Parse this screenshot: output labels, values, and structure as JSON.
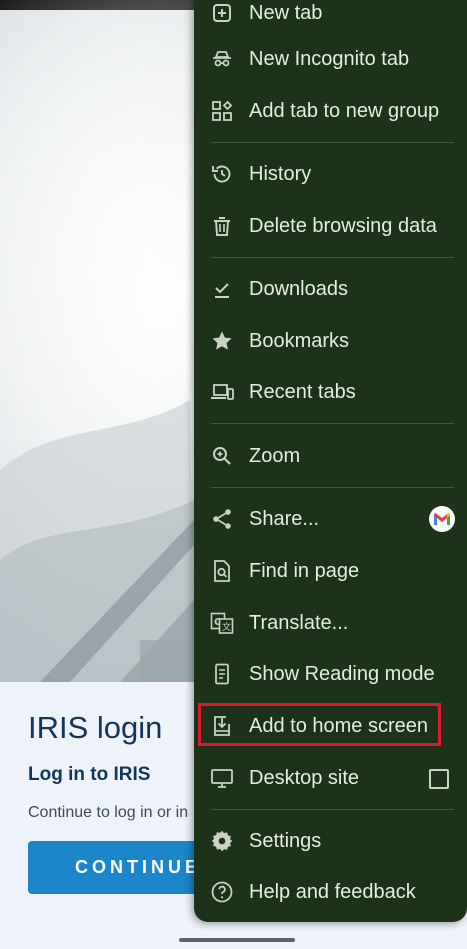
{
  "background_page": {
    "login_title": "IRIS login",
    "login_subtitle": "Log in to IRIS",
    "login_text": "Continue to log in or in",
    "continue_label": "CONTINUE"
  },
  "menu": {
    "items": [
      {
        "label": "New tab",
        "icon": "plus-square-icon"
      },
      {
        "label": "New Incognito tab",
        "icon": "incognito-icon"
      },
      {
        "label": "Add tab to new group",
        "icon": "tab-group-icon"
      },
      {
        "label": "History",
        "icon": "history-icon"
      },
      {
        "label": "Delete browsing data",
        "icon": "trash-icon"
      },
      {
        "label": "Downloads",
        "icon": "download-check-icon"
      },
      {
        "label": "Bookmarks",
        "icon": "star-icon"
      },
      {
        "label": "Recent tabs",
        "icon": "devices-icon"
      },
      {
        "label": "Zoom",
        "icon": "zoom-icon"
      },
      {
        "label": "Share...",
        "icon": "share-icon"
      },
      {
        "label": "Find in page",
        "icon": "find-in-page-icon"
      },
      {
        "label": "Translate...",
        "icon": "translate-icon"
      },
      {
        "label": "Show Reading mode",
        "icon": "reading-mode-icon"
      },
      {
        "label": "Add to home screen",
        "icon": "add-to-home-icon"
      },
      {
        "label": "Desktop site",
        "icon": "monitor-icon"
      },
      {
        "label": "Settings",
        "icon": "gear-icon"
      },
      {
        "label": "Help and feedback",
        "icon": "help-icon"
      }
    ],
    "highlighted_item": "Add to home screen",
    "desktop_site_checked": false
  },
  "colors": {
    "menu_background": "#1c3219",
    "menu_text": "#e6ece2",
    "highlight_border": "#e0182d",
    "continue_button": "#1a86c9",
    "login_title": "#12355b"
  }
}
